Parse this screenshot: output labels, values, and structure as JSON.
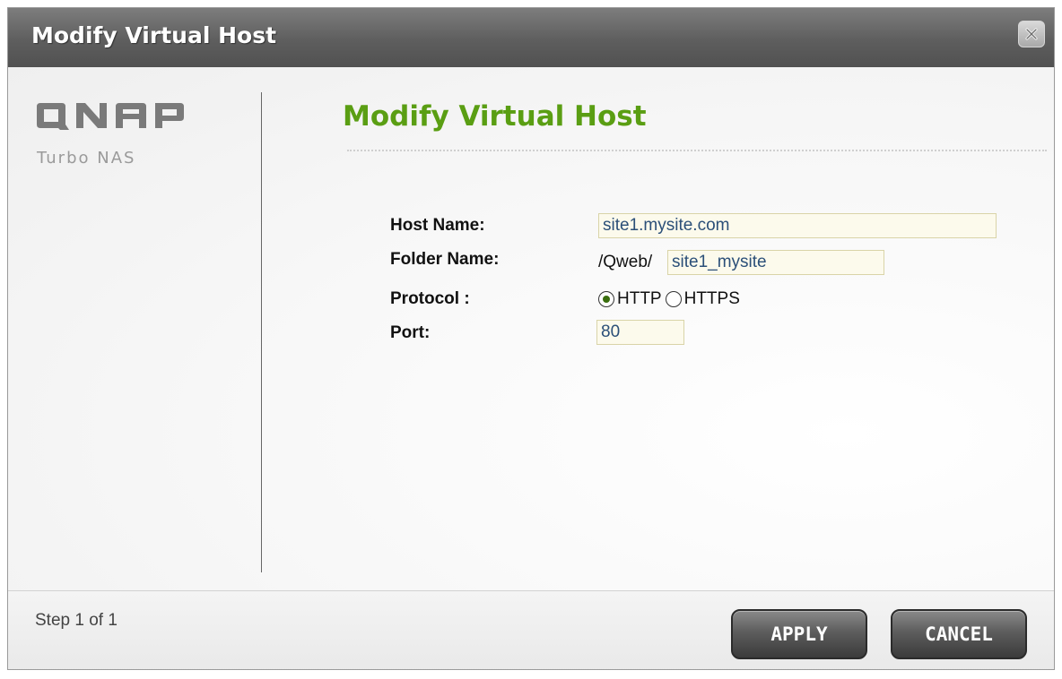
{
  "window": {
    "title": "Modify Virtual Host",
    "close_symbol": "x"
  },
  "brand": {
    "logo_alt": "QNAP",
    "subtitle": "Turbo NAS"
  },
  "heading": "Modify Virtual Host",
  "form": {
    "host_name": {
      "label": "Host Name:",
      "value": "site1.mysite.com"
    },
    "folder_name": {
      "label": "Folder Name:",
      "prefix": "/Qweb/",
      "value": "site1_mysite"
    },
    "protocol": {
      "label": "Protocol :",
      "options": [
        {
          "label": "HTTP",
          "selected": true
        },
        {
          "label": "HTTPS",
          "selected": false
        }
      ]
    },
    "port": {
      "label": "Port:",
      "value": "80"
    }
  },
  "footer": {
    "step_text": "Step 1 of 1",
    "apply_label": "APPLY",
    "cancel_label": "CANCEL"
  },
  "colors": {
    "heading": "#5a9e13",
    "title_bar": "#5e5e5e",
    "input_bg": "#fcfaec",
    "input_text": "#2b4f78"
  },
  "icons": {
    "close": "close-icon",
    "logo": "qnap-logo"
  }
}
